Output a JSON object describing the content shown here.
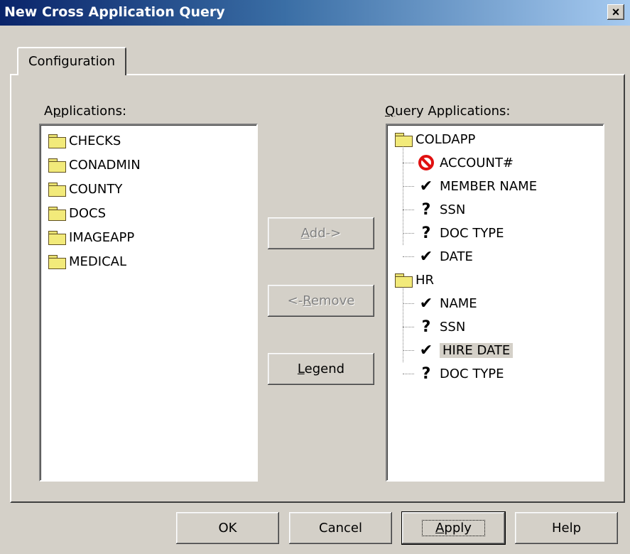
{
  "window": {
    "title": "New Cross Application Query",
    "close": "×"
  },
  "tabs": [
    {
      "label": "Configuration"
    }
  ],
  "applications": {
    "label_pre": "A",
    "label_u": "p",
    "label_post": "plications:",
    "items": [
      "CHECKS",
      "CONADMIN",
      "COUNTY",
      "DOCS",
      "IMAGEAPP",
      "MEDICAL"
    ]
  },
  "query": {
    "label_u": "Q",
    "label_post": "uery Applications:",
    "groups": [
      {
        "name": "COLDAPP",
        "fields": [
          {
            "name": "ACCOUNT#",
            "status": "excluded"
          },
          {
            "name": "MEMBER NAME",
            "status": "✔"
          },
          {
            "name": "SSN",
            "status": "?"
          },
          {
            "name": "DOC TYPE",
            "status": "?"
          },
          {
            "name": "DATE",
            "status": "✔"
          }
        ]
      },
      {
        "name": "HR",
        "fields": [
          {
            "name": "NAME",
            "status": "✔"
          },
          {
            "name": "SSN",
            "status": "?"
          },
          {
            "name": "HIRE DATE",
            "status": "✔",
            "selected": true
          },
          {
            "name": "DOC TYPE",
            "status": "?"
          }
        ]
      }
    ]
  },
  "buttons": {
    "add": {
      "u": "A",
      "rest": "dd->"
    },
    "remove": {
      "pre": "<-",
      "u": "R",
      "rest": "emove"
    },
    "legend": {
      "u": "L",
      "rest": "egend"
    },
    "ok": "OK",
    "cancel": "Cancel",
    "apply": {
      "u": "A",
      "rest": "pply"
    },
    "help": "Help"
  }
}
